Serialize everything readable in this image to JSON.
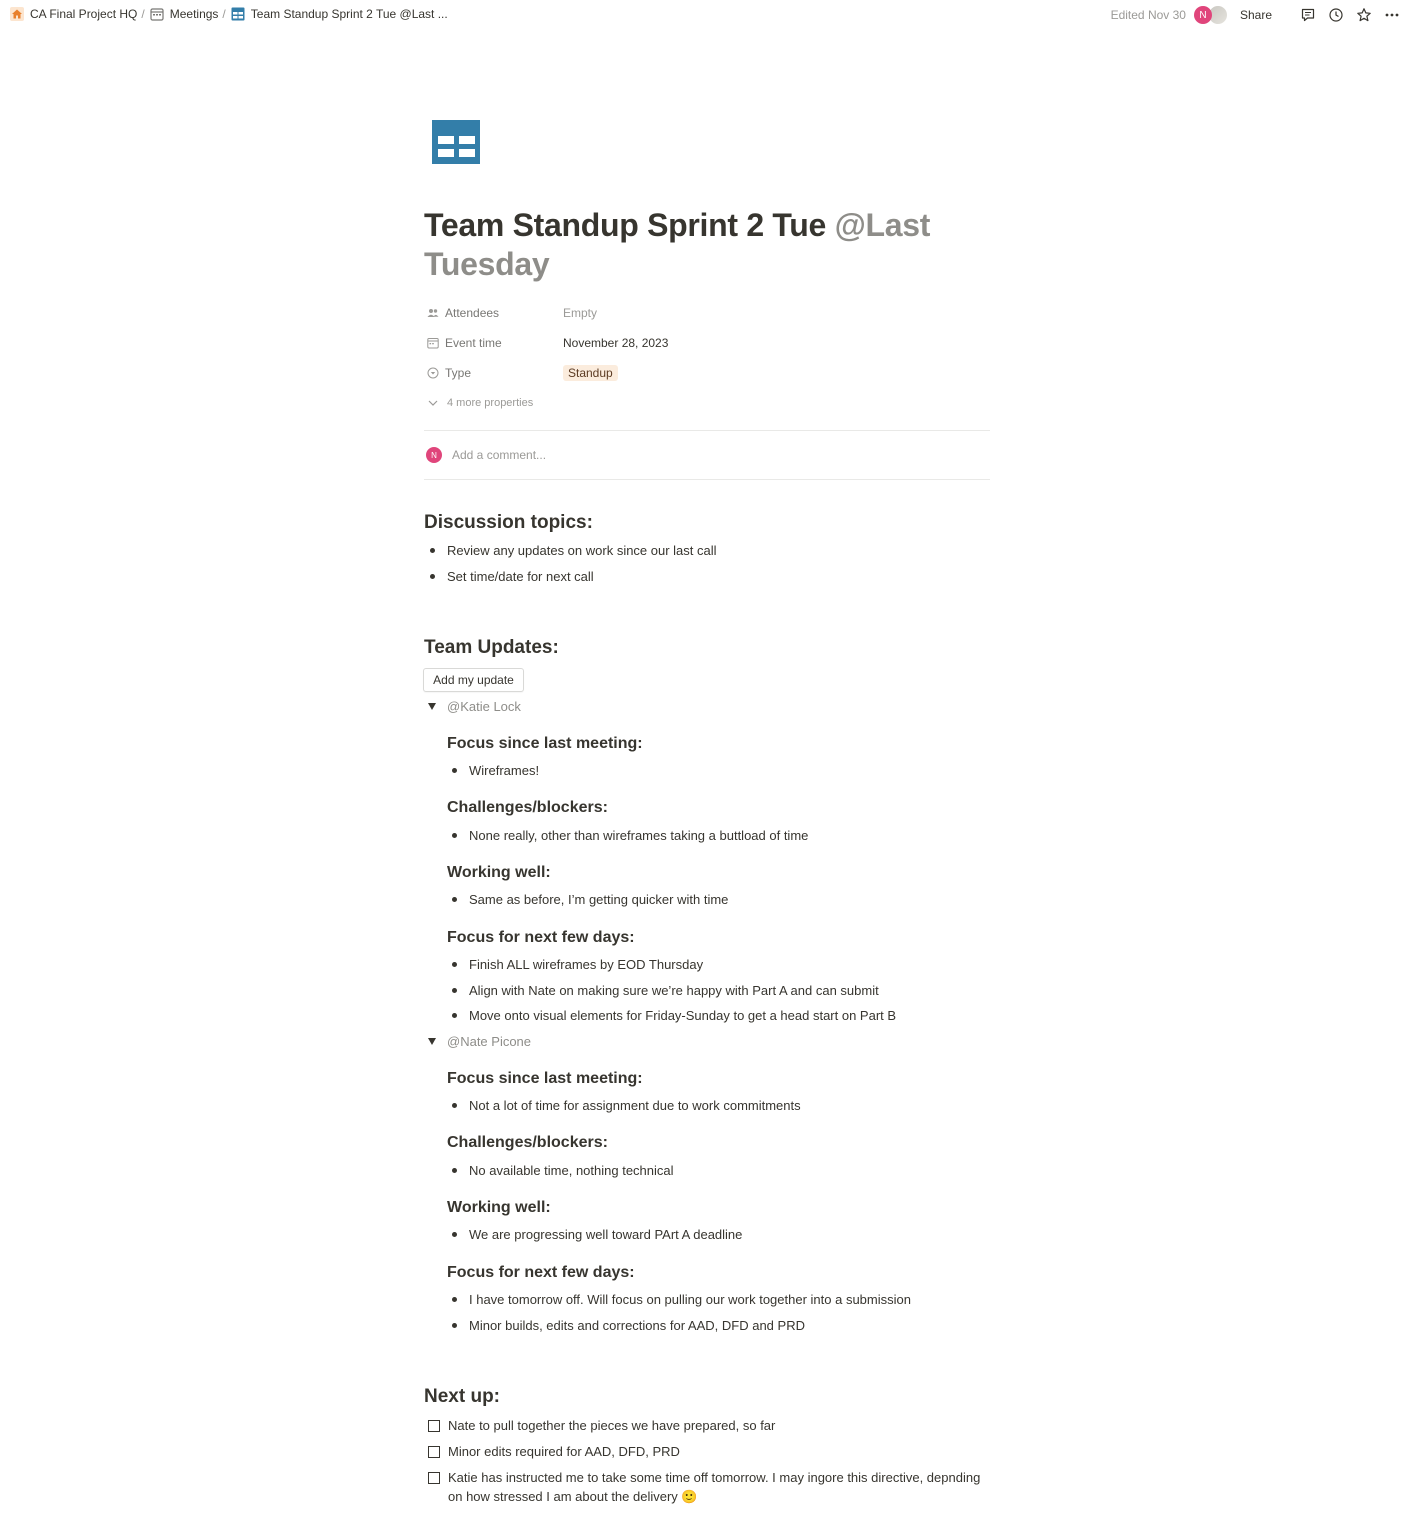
{
  "breadcrumbs": [
    "CA Final Project HQ",
    "Meetings",
    "Team Standup Sprint 2 Tue @Last ..."
  ],
  "topbar": {
    "edited": "Edited Nov 30",
    "avatar_initial": "N",
    "share": "Share",
    "icons": [
      "comments-icon",
      "history-icon",
      "favorite-star-icon",
      "more-options-icon"
    ]
  },
  "page": {
    "icon": "table-icon",
    "title": "Team Standup Sprint 2 Tue ",
    "title_mention": "@Last Tuesday"
  },
  "properties": {
    "attendees": {
      "label": "Attendees",
      "value": "Empty"
    },
    "event_time": {
      "label": "Event time",
      "value": "November 28, 2023"
    },
    "type": {
      "label": "Type",
      "value": "Standup"
    },
    "more": "4 more properties"
  },
  "comment": {
    "avatar_initial": "N",
    "placeholder": "Add a comment..."
  },
  "discussion": {
    "heading": "Discussion topics:",
    "items": [
      "Review any updates on work since our last call",
      "Set time/date for next call"
    ]
  },
  "team_updates": {
    "heading": "Team Updates:",
    "add_button": "Add my update",
    "members": [
      {
        "name": "@Katie Lock",
        "focus_since_heading": "Focus since last meeting:",
        "focus_since": [
          "Wireframes!"
        ],
        "challenges_heading": "Challenges/blockers:",
        "challenges": [
          "None really, other than wireframes taking a buttload of time"
        ],
        "working_heading": "Working well:",
        "working": [
          "Same as before, I’m getting quicker with time"
        ],
        "focus_next_heading": "Focus for next few days:",
        "focus_next": [
          "Finish ALL wireframes by EOD Thursday",
          "Align with Nate on making sure we’re happy with Part A and can submit",
          "Move onto visual elements for Friday-Sunday to get a head start on Part B"
        ]
      },
      {
        "name": "@Nate Picone",
        "focus_since_heading": "Focus since last meeting:",
        "focus_since": [
          "Not a lot of time for assignment due to work commitments"
        ],
        "challenges_heading": "Challenges/blockers:",
        "challenges": [
          "No available time, nothing technical"
        ],
        "working_heading": "Working well:",
        "working": [
          "We are progressing well toward PArt A deadline"
        ],
        "focus_next_heading": "Focus for next few days:",
        "focus_next": [
          "I have tomorrow off. Will focus on pulling our work together into a submission",
          "Minor builds, edits and corrections for AAD, DFD and PRD"
        ]
      }
    ]
  },
  "next_up": {
    "heading": "Next up:",
    "todos": [
      "Nate to pull together the pieces we have prepared, so far",
      "Minor edits required for AAD, DFD, PRD",
      "Katie has instructed me to take some time off tomorrow. I may ingore this directive, depnding on how stressed I am about the delivery 🙂"
    ]
  }
}
